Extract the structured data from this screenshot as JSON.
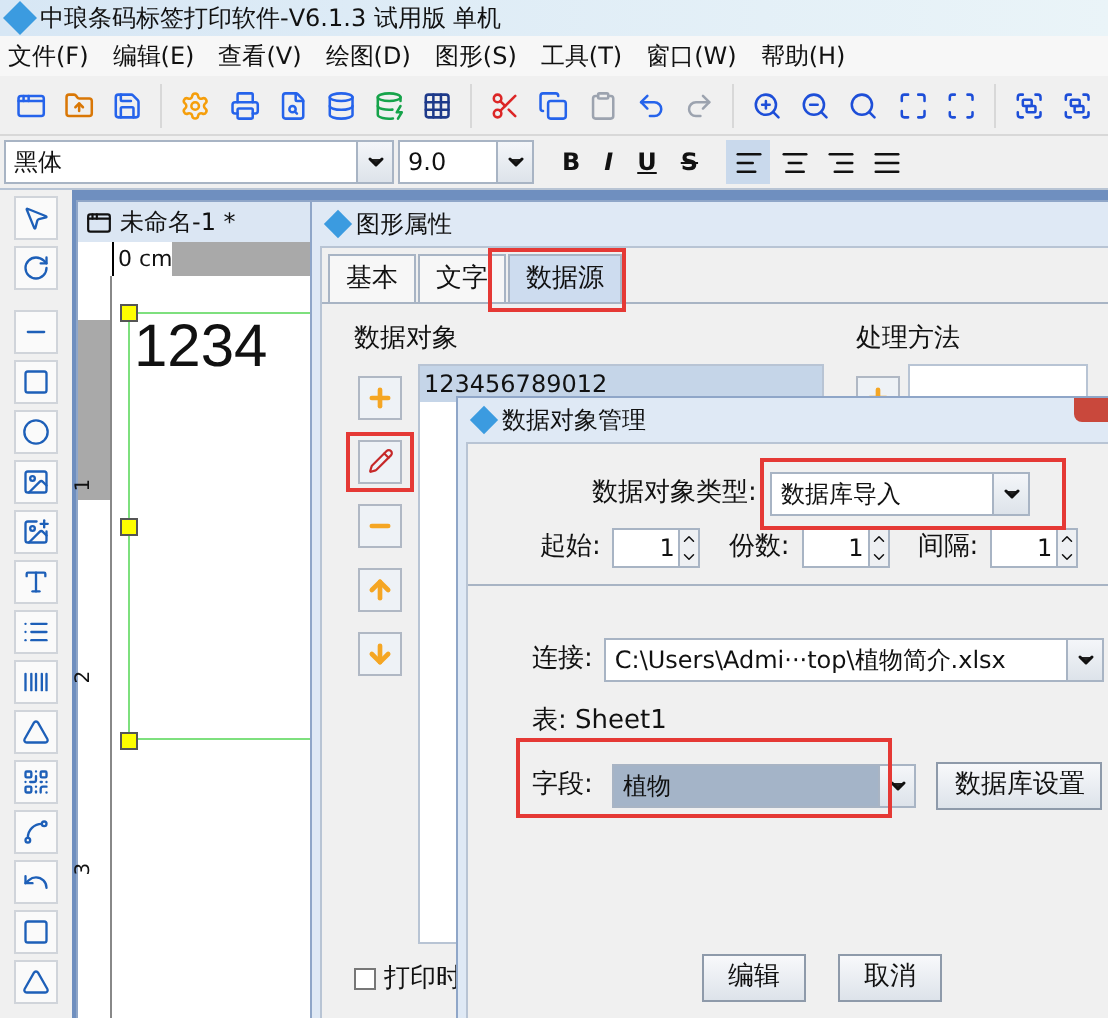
{
  "app_title": "中琅条码标签打印软件-V6.1.3 试用版 单机",
  "menu": [
    "文件(F)",
    "编辑(E)",
    "查看(V)",
    "绘图(D)",
    "图形(S)",
    "工具(T)",
    "窗口(W)",
    "帮助(H)"
  ],
  "font_bar": {
    "font": "黑体",
    "size": "9.0",
    "styles": [
      "B",
      "I",
      "U",
      "S"
    ]
  },
  "document": {
    "title": "未命名-1 *",
    "ruler_unit": "0 cm",
    "ruler_marks": [
      "1",
      "2",
      "3"
    ],
    "content": "1234"
  },
  "properties_dialog": {
    "title": "图形属性",
    "tabs": [
      {
        "label": "基本",
        "selected": false,
        "highlighted": false
      },
      {
        "label": "文字",
        "selected": false,
        "highlighted": false
      },
      {
        "label": "数据源",
        "selected": true,
        "highlighted": true
      }
    ],
    "data_objects": {
      "label": "数据对象",
      "items": [
        {
          "text": "123456789012",
          "selected": true
        }
      ],
      "edit_highlighted": true
    },
    "processing": {
      "label": "处理方法"
    },
    "print_option": {
      "label": "打印时",
      "checked": false
    }
  },
  "manager_dialog": {
    "title": "数据对象管理",
    "type": {
      "label": "数据对象类型:",
      "value": "数据库导入",
      "highlighted": true
    },
    "spinners": [
      {
        "label": "起始:",
        "value": "1"
      },
      {
        "label": "份数:",
        "value": "1"
      },
      {
        "label": "间隔:",
        "value": "1"
      }
    ],
    "connection": {
      "label": "连接:",
      "value": "C:\\Users\\Admi···top\\植物简介.xlsx"
    },
    "table": "表: Sheet1",
    "field": {
      "label": "字段:",
      "value": "植物",
      "highlighted": true
    },
    "db_settings": "数据库设置",
    "buttons": [
      "编辑",
      "取消"
    ]
  }
}
